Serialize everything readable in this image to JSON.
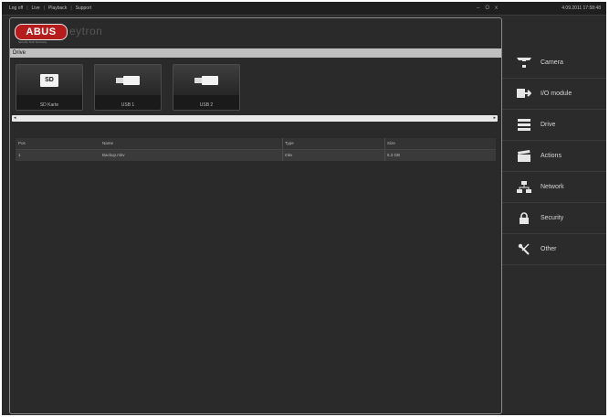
{
  "topbar": {
    "menu": [
      "Log off",
      "Live",
      "Playback",
      "Support"
    ],
    "window_controls": [
      "–",
      "O",
      "x"
    ],
    "clock": "4.09.2011 17:58:48"
  },
  "brand": {
    "logo_text": "ABUS",
    "logo_sub": "Security Tech Germany",
    "product": "eytron"
  },
  "section": {
    "title": "Drive"
  },
  "drives": [
    {
      "label": "SD Karte",
      "icon": "sd-card-icon",
      "icon_text": "SD"
    },
    {
      "label": "USB 1",
      "icon": "usb-icon"
    },
    {
      "label": "USB 2",
      "icon": "usb-icon"
    }
  ],
  "table": {
    "headers": [
      "Pos",
      "Name",
      "Type",
      "Size"
    ],
    "rows": [
      {
        "pos": "1",
        "name": "Backup.mkv",
        "type": "mkv",
        "size": "5.3 GB"
      }
    ]
  },
  "sidebar": {
    "items": [
      {
        "label": "Camera",
        "icon": "camera-icon"
      },
      {
        "label": "I/O module",
        "icon": "io-module-icon"
      },
      {
        "label": "Drive",
        "icon": "drive-icon"
      },
      {
        "label": "Actions",
        "icon": "clapperboard-icon"
      },
      {
        "label": "Network",
        "icon": "network-icon"
      },
      {
        "label": "Security",
        "icon": "lock-icon"
      },
      {
        "label": "Other",
        "icon": "tools-icon"
      }
    ]
  }
}
